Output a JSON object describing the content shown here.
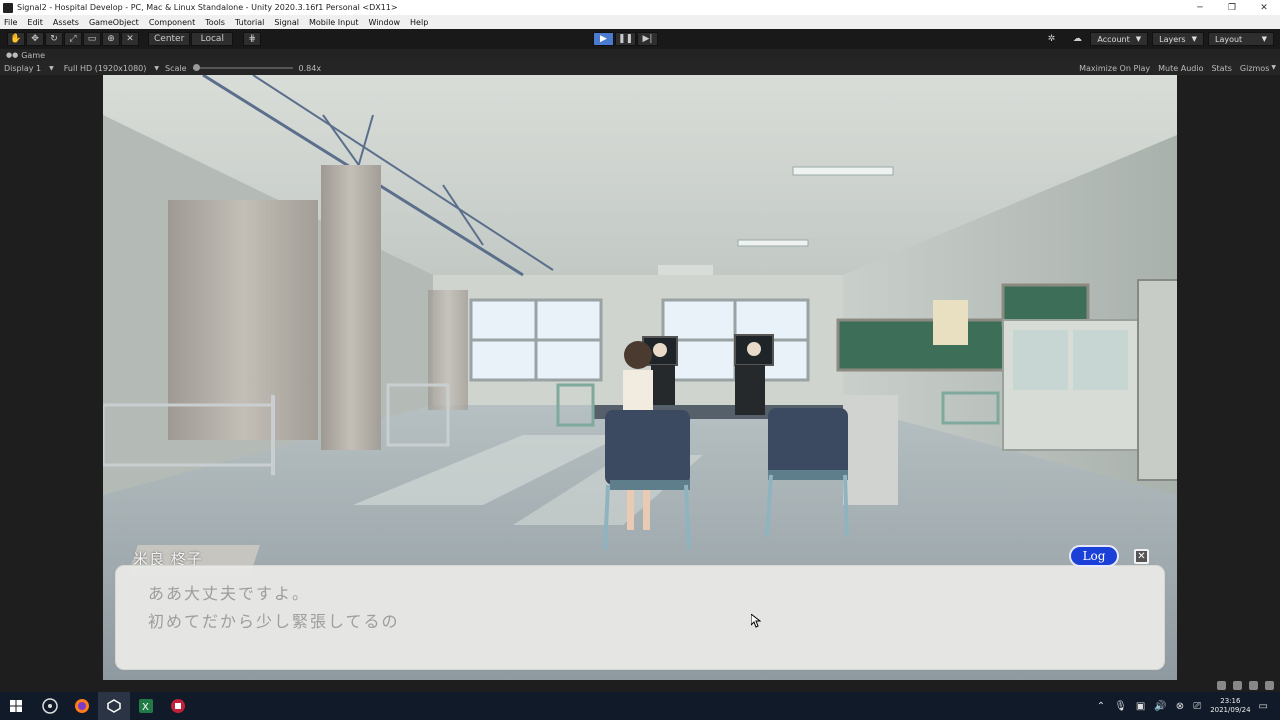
{
  "window": {
    "title": "Signal2 - Hospital Develop - PC, Mac & Linux Standalone - Unity 2020.3.16f1 Personal <DX11>",
    "minimize": "─",
    "maximize": "❐",
    "close": "✕"
  },
  "menu": [
    "File",
    "Edit",
    "Assets",
    "GameObject",
    "Component",
    "Tools",
    "Tutorial",
    "Signal",
    "Mobile Input",
    "Window",
    "Help"
  ],
  "toolbar": {
    "pivot": "Center",
    "space": "Local",
    "account": "Account",
    "layers": "Layers",
    "layout": "Layout"
  },
  "tab": {
    "label": "Game"
  },
  "gamebar": {
    "display": "Display 1",
    "resolution": "Full HD (1920x1080)",
    "scale_label": "Scale",
    "scale_value": "0.84x",
    "maximize": "Maximize On Play",
    "mute": "Mute Audio",
    "stats": "Stats",
    "gizmos": "Gizmos"
  },
  "game": {
    "speaker": "米良 柊子",
    "line1": "ああ大丈夫ですよ。",
    "line2": "初めてだから少し緊張してるの",
    "log_label": "Log",
    "close_label": "✕"
  },
  "taskbar": {
    "time": "23:16",
    "date": "2021/09/24"
  },
  "colors": {
    "log_button": "#1b40d8",
    "play_active": "#4a7bd0",
    "taskbar": "#101a28"
  }
}
